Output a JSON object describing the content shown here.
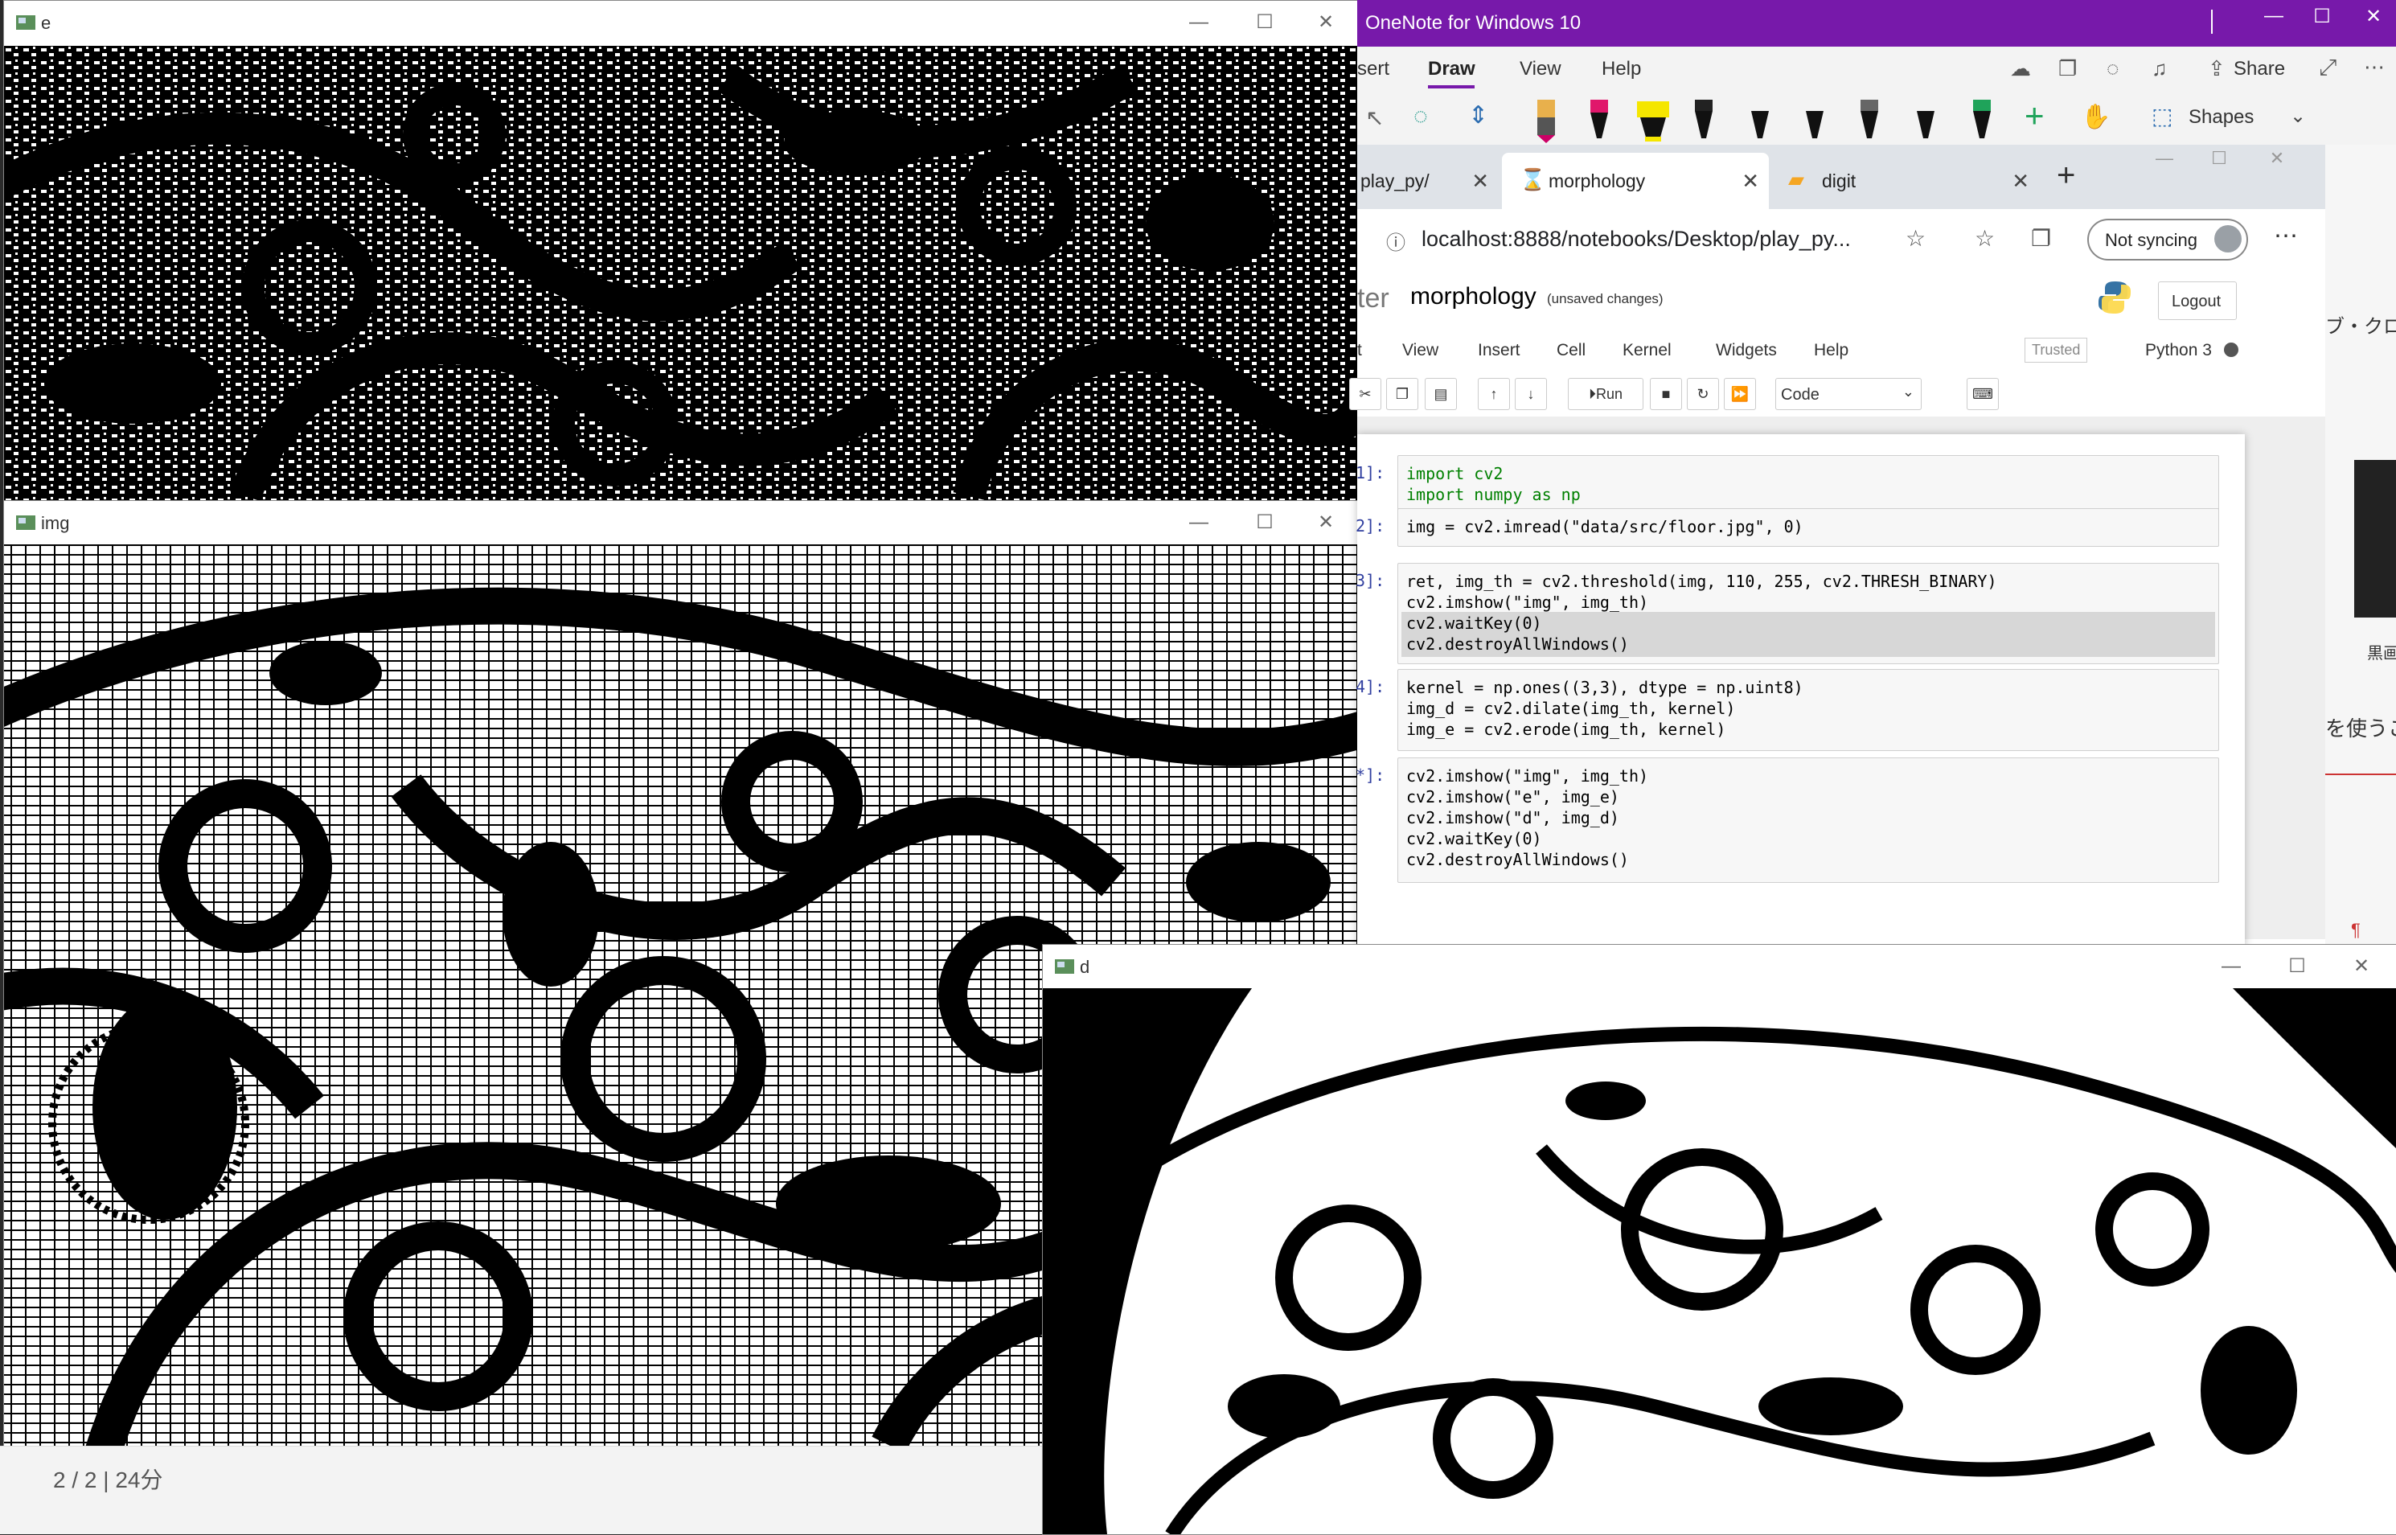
{
  "windows": {
    "e": {
      "title": "e"
    },
    "img": {
      "title": "img"
    },
    "d": {
      "title": "d"
    }
  },
  "status_text": "2 / 2 | 24分",
  "onenote": {
    "title": "OneNote for Windows 10",
    "menus": [
      "sert",
      "Draw",
      "View",
      "Help"
    ],
    "share_label": "Share",
    "shapes_label": "Shapes",
    "accent": "#7719aa"
  },
  "browser": {
    "tabs": [
      {
        "label": "play_py/"
      },
      {
        "label": "morphology"
      },
      {
        "label": "digit"
      }
    ],
    "url": "localhost:8888/notebooks/Desktop/play_py...",
    "sync_label": "Not syncing"
  },
  "jupyter": {
    "logo_text": "ter",
    "notebook_name": "morphology",
    "save_status": "(unsaved changes)",
    "logout_label": "Logout",
    "menus": [
      "t",
      "View",
      "Insert",
      "Cell",
      "Kernel",
      "Widgets",
      "Help"
    ],
    "trusted_label": "Trusted",
    "kernel_label": "Python 3",
    "run_label": "Run",
    "cell_type": "Code",
    "cells": [
      {
        "prompt": "1]:",
        "lines": [
          "import cv2",
          "import numpy as np"
        ]
      },
      {
        "prompt": "2]:",
        "lines": [
          "img = cv2.imread(\"data/src/floor.jpg\", 0)"
        ]
      },
      {
        "prompt": "3]:",
        "lines": [
          "ret, img_th = cv2.threshold(img, 110, 255, cv2.THRESH_BINARY)",
          "cv2.imshow(\"img\", img_th)",
          "cv2.waitKey(0)",
          "cv2.destroyAllWindows()"
        ]
      },
      {
        "prompt": "4]:",
        "lines": [
          "kernel = np.ones((3,3), dtype = np.uint8)",
          "img_d = cv2.dilate(img_th, kernel)",
          "img_e = cv2.erode(img_th, kernel)"
        ]
      },
      {
        "prompt": "*]:",
        "lines": [
          "cv2.imshow(\"img\", img_th)",
          "cv2.imshow(\"e\", img_e)",
          "cv2.imshow(\"d\", img_d)",
          "cv2.waitKey(0)",
          "cv2.destroyAllWindows()"
        ]
      }
    ]
  },
  "side_text": {
    "top": "ブ・クロ",
    "mid": "黒画",
    "lower": "を使うこ",
    "mark": "¶"
  }
}
